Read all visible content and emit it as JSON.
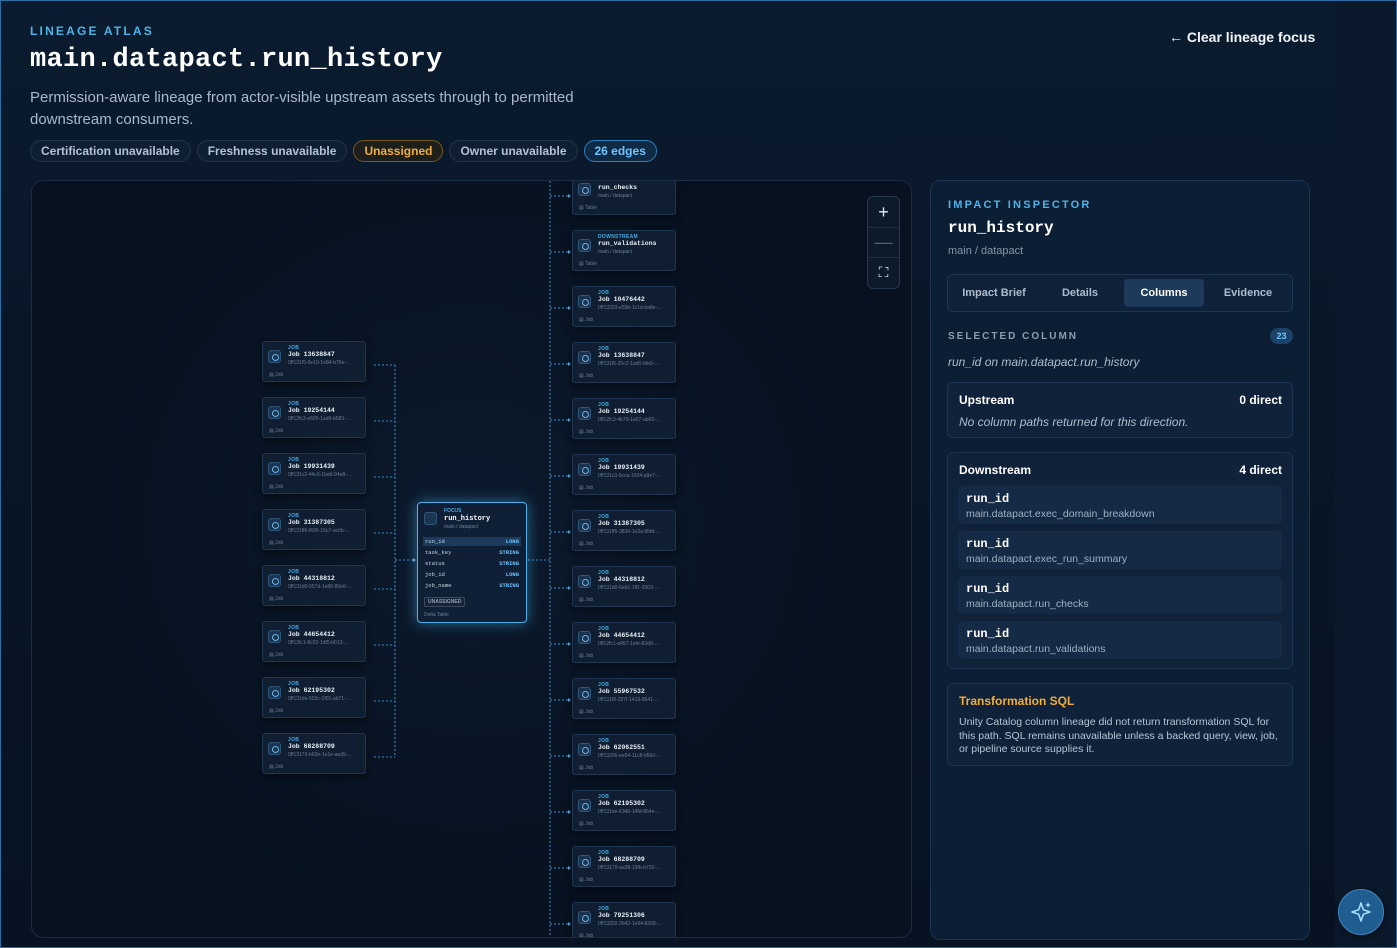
{
  "header": {
    "eyebrow": "LINEAGE ATLAS",
    "title": "main.datapact.run_history",
    "subtitle": "Permission-aware lineage from actor-visible upstream assets through to permitted downstream consumers.",
    "clear_link": "← Clear lineage focus",
    "pills": [
      "Certification unavailable",
      "Freshness unavailable",
      "Unassigned",
      "Owner unavailable",
      "26 edges"
    ]
  },
  "graph": {
    "upstream": [
      {
        "kind": "JOB",
        "name": "Job 13638847",
        "sub": "0ff131f5-0e10-1e84-b79e-…",
        "foot": "Job"
      },
      {
        "kind": "JOB",
        "name": "Job 19254144",
        "sub": "0ff12fc3-e605-1ad6-b583-…",
        "foot": "Job"
      },
      {
        "kind": "JOB",
        "name": "Job 19931439",
        "sub": "0ff131c2-44c9-1bdd-94e8-…",
        "foot": "Job"
      },
      {
        "kind": "JOB",
        "name": "Job 31387305",
        "sub": "0ff131ff6-f695-16c7-ac6b-…",
        "foot": "Job"
      },
      {
        "kind": "JOB",
        "name": "Job 44318812",
        "sub": "0ff131d0-057d-1e88-86e6-…",
        "foot": "Job"
      },
      {
        "kind": "JOB",
        "name": "Job 44654412",
        "sub": "0ff12fc1-8c03-1df5-b013-…",
        "foot": "Job"
      },
      {
        "kind": "JOB",
        "name": "Job 62195302",
        "sub": "0ff131de-553c-1f01-ab71-…",
        "foot": "Job"
      },
      {
        "kind": "JOB",
        "name": "Job 68288709",
        "sub": "0ff13179-b63e-1e1e-aed5-…",
        "foot": "Job"
      }
    ],
    "focus": {
      "kind": "FOCUS",
      "name": "run_history",
      "sub": "main / datapact",
      "columns": [
        {
          "name": "run_id",
          "type": "LONG"
        },
        {
          "name": "task_key",
          "type": "STRING"
        },
        {
          "name": "status",
          "type": "STRING"
        },
        {
          "name": "job_id",
          "type": "LONG"
        },
        {
          "name": "job_name",
          "type": "STRING"
        }
      ],
      "badge": "UNASSIGNED",
      "foot": "Delta Table"
    },
    "downstream": [
      {
        "kind": "",
        "name": "run_checks",
        "sub": "main / datapact",
        "foot": "Table"
      },
      {
        "kind": "DOWNSTREAM",
        "name": "run_validations",
        "sub": "main / datapact",
        "foot": "Table"
      },
      {
        "kind": "JOB",
        "name": "Job 10476442",
        "sub": "0ff13203-e59b-1c1d-ba8e-…",
        "foot": "Job"
      },
      {
        "kind": "JOB",
        "name": "Job 13638847",
        "sub": "0ff131f5-25c2-1ad0-bfe0-…",
        "foot": "Job"
      },
      {
        "kind": "JOB",
        "name": "Job 19254144",
        "sub": "0ff12fc3-4b79-1a07-ab69-…",
        "foot": "Job"
      },
      {
        "kind": "JOB",
        "name": "Job 19931439",
        "sub": "0ff131c3-5cca-1034-a9e7-…",
        "foot": "Job"
      },
      {
        "kind": "JOB",
        "name": "Job 31387305",
        "sub": "0ff131ff6-3839-1e3a-9fdd-…",
        "foot": "Job"
      },
      {
        "kind": "JOB",
        "name": "Job 44318812",
        "sub": "0ff131d0-6eb1-1ff1-9303-…",
        "foot": "Job"
      },
      {
        "kind": "JOB",
        "name": "Job 44654412",
        "sub": "0ff12fc1-a457-1efe-82d0-…",
        "foot": "Job"
      },
      {
        "kind": "JOB",
        "name": "Job 55967532",
        "sub": "0ff131f8-287f-1419-8641-…",
        "foot": "Job"
      },
      {
        "kind": "JOB",
        "name": "Job 62062551",
        "sub": "0ff13206-ee54-11c8-b5b0-…",
        "foot": "Job"
      },
      {
        "kind": "JOB",
        "name": "Job 62195302",
        "sub": "0ff131de-6346-14fd-864e-…",
        "foot": "Job"
      },
      {
        "kind": "JOB",
        "name": "Job 68288709",
        "sub": "0ff13179-aa38-19fb-b732-…",
        "foot": "Job"
      },
      {
        "kind": "JOB",
        "name": "Job 79251306",
        "sub": "0ff13202-2b42-1e94-8308-…",
        "foot": "Job"
      }
    ],
    "zoom": {
      "plus": "+",
      "minus": "—",
      "fit": "⛶"
    }
  },
  "inspector": {
    "eyebrow": "IMPACT INSPECTOR",
    "title": "run_history",
    "sub": "main / datapact",
    "tabs": [
      "Impact Brief",
      "Details",
      "Columns",
      "Evidence"
    ],
    "active_tab": "Columns",
    "section_label": "SELECTED COLUMN",
    "count": "23",
    "selected_column": "run_id on main.datapact.run_history",
    "upstream": {
      "title": "Upstream",
      "count": "0 direct",
      "empty": "No column paths returned for this direction."
    },
    "downstream": {
      "title": "Downstream",
      "count": "4 direct",
      "paths": [
        {
          "column": "run_id",
          "table": "main.datapact.exec_domain_breakdown"
        },
        {
          "column": "run_id",
          "table": "main.datapact.exec_run_summary"
        },
        {
          "column": "run_id",
          "table": "main.datapact.run_checks"
        },
        {
          "column": "run_id",
          "table": "main.datapact.run_validations"
        }
      ]
    },
    "sql": {
      "title": "Transformation SQL",
      "body": "Unity Catalog column lineage did not return transformation SQL for this path. SQL remains unavailable unless a backed query, view, job, or pipeline source supplies it."
    }
  },
  "colors": {
    "accent": "#4fb3e8",
    "warning": "#f0ad3a",
    "background": "#071424"
  },
  "icons": {
    "assistant": "sparkle-icon",
    "node": "clock-icon",
    "table": "table-icon"
  }
}
